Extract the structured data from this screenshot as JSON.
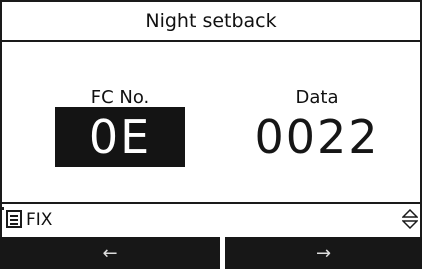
{
  "header": {
    "title": "Night setback"
  },
  "fields": {
    "fc_label": "FC No.",
    "fc_value": "0E",
    "data_label": "Data",
    "data_value": "0022"
  },
  "status_bar": {
    "menu_icon": "menu-list-icon",
    "mode_label": "FIX",
    "scroll_icon": "up-down-arrow-icon"
  },
  "softkeys": {
    "left_label": "←",
    "right_label": "→"
  }
}
